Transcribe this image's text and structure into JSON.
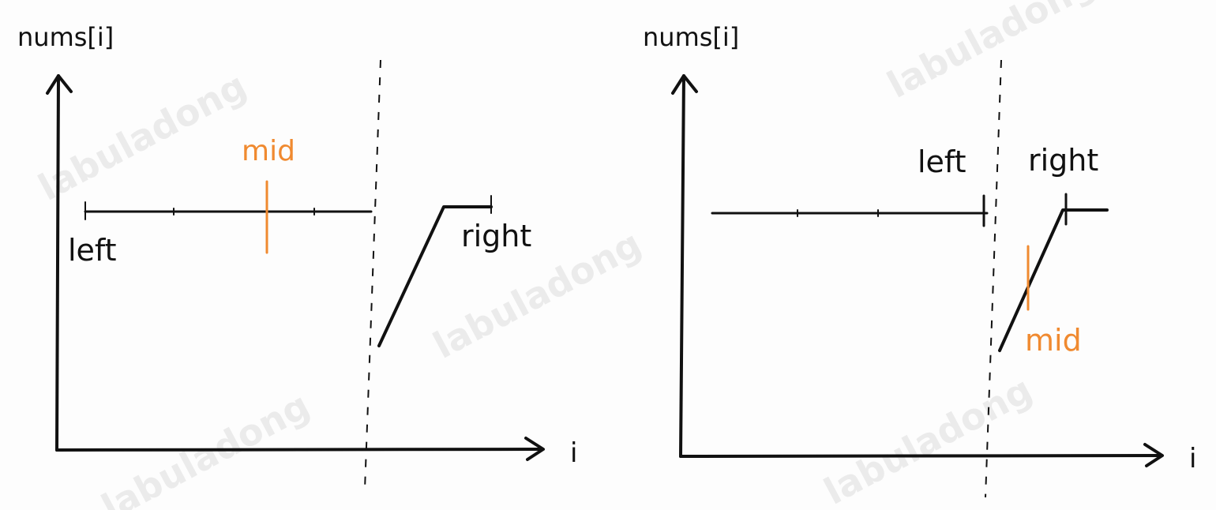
{
  "watermark": "labuladong",
  "colors": {
    "ink": "#111111",
    "accent": "#f08a30",
    "watermark": "#e6e6e6"
  },
  "panels": [
    {
      "y_axis_label": "nums[i]",
      "x_axis_label": "i",
      "left_label": "left",
      "mid_label": "mid",
      "right_label": "right"
    },
    {
      "y_axis_label": "nums[i]",
      "x_axis_label": "i",
      "left_label": "left",
      "mid_label": "mid",
      "right_label": "right"
    }
  ]
}
